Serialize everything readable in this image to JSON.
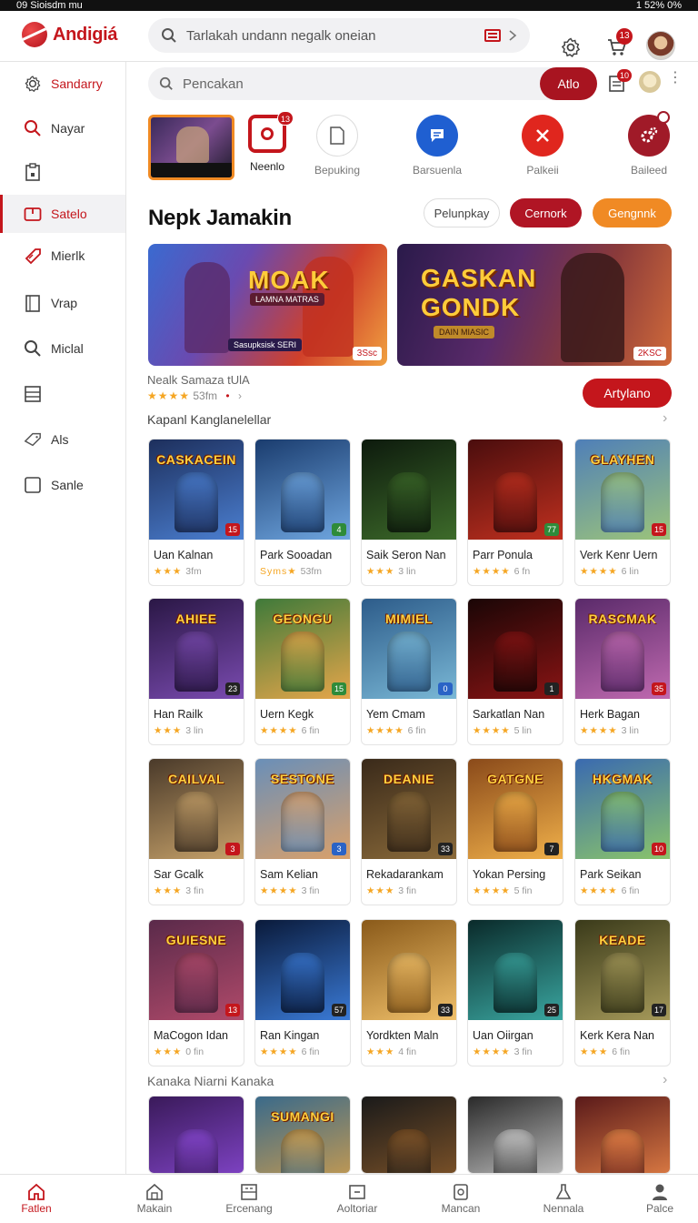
{
  "status_bar": {
    "left": "09 Sioisdm mu",
    "right": "1 52% 0%"
  },
  "app": {
    "name": "Andigiá",
    "brand_color": "#c4161c"
  },
  "top_search": {
    "placeholder": "Tarlakah undann negalk oneian"
  },
  "top_icons": {
    "cart_badge": "13"
  },
  "sidebar": {
    "items": [
      {
        "label": "Sandarry",
        "icon": "gear-icon"
      },
      {
        "label": "Nayar",
        "icon": "search-icon"
      },
      {
        "label": "",
        "icon": "clipboard-icon"
      },
      {
        "label": "Satelo",
        "icon": "folder-icon",
        "active": true
      },
      {
        "label": "Mierlk",
        "icon": "tag-icon"
      },
      {
        "label": "Vrap",
        "icon": "document-icon"
      },
      {
        "label": "Miclal",
        "icon": "search-icon"
      },
      {
        "label": "",
        "icon": "list-icon"
      },
      {
        "label": "Als",
        "icon": "ticket-icon"
      },
      {
        "label": "Sanle",
        "icon": "square-icon"
      }
    ]
  },
  "sub_search": {
    "placeholder": "Pencakan",
    "button": "Atlo",
    "inbox_badge": "10"
  },
  "quick_actions": [
    {
      "label": "Neenlo",
      "badge": "13"
    },
    {
      "label": "Bepuking"
    },
    {
      "label": "Barsuenla"
    },
    {
      "label": "Palkeii"
    },
    {
      "label": "Baileed"
    }
  ],
  "section": {
    "title": "Nepk Jamakin",
    "pills": [
      "Pelunpkay",
      "Cernork",
      "Gengnnk"
    ]
  },
  "banners": [
    {
      "title": "MOAK",
      "subtitle": "LAMNA MATRAS",
      "caption": "Sasupksisk SERI",
      "tag": "3Ssc"
    },
    {
      "title": "GASKAN GONDK",
      "subtitle": "DAIN MIASIC",
      "tag": "2KSC"
    }
  ],
  "featured": {
    "name": "Nealk Samaza tUlA",
    "stars": "★★★★",
    "rating_text": "53fm",
    "action": "Artylano"
  },
  "row_headers": [
    "Kapanl Kanglanelellar",
    "Kanaka Niarni Kanaka"
  ],
  "grid": [
    {
      "name": "Uan Kalnan",
      "stars": "★★★",
      "meta": "3fm",
      "art": "CASKACEIN",
      "num": "15",
      "num_style": "red",
      "c1": "#1d2f5c",
      "c2": "#4b7fd1"
    },
    {
      "name": "Park Sooadan",
      "stars": "Syms★",
      "meta": "53fm",
      "art": "",
      "num": "4",
      "num_style": "green",
      "c1": "#1a3c6e",
      "c2": "#6fa6e0"
    },
    {
      "name": "Saik Seron Nan",
      "stars": "★★★",
      "meta": "3 lin",
      "art": "",
      "num": "",
      "num_style": "dark",
      "c1": "#0d1a0d",
      "c2": "#3d6b2a"
    },
    {
      "name": "Parr Ponula",
      "stars": "★★★★",
      "meta": "6 fn",
      "art": "",
      "num": "77",
      "num_style": "green",
      "c1": "#4a0d0d",
      "c2": "#c0301f"
    },
    {
      "name": "Verk Kenr Uern",
      "stars": "★★★★",
      "meta": "6 lin",
      "art": "GLAYHEN",
      "num": "15",
      "num_style": "red",
      "c1": "#4f7fb8",
      "c2": "#9cc47a"
    },
    {
      "name": "Han Railk",
      "stars": "★★★",
      "meta": "3 lin",
      "art": "AHIEE",
      "num": "23",
      "num_style": "dark",
      "c1": "#2a1745",
      "c2": "#7a4bb0"
    },
    {
      "name": "Uern Kegk",
      "stars": "★★★★",
      "meta": "6 fin",
      "art": "GEONGU",
      "num": "15",
      "num_style": "green",
      "c1": "#3f7a3a",
      "c2": "#e6a64a"
    },
    {
      "name": "Yem Cmam",
      "stars": "★★★★",
      "meta": "6 fin",
      "art": "MIMIEL",
      "num": "0",
      "num_style": "blue",
      "c1": "#2d5c8a",
      "c2": "#7ab8d6"
    },
    {
      "name": "Sarkatlan Nan",
      "stars": "★★★★",
      "meta": "5 lin",
      "art": "",
      "num": "1",
      "num_style": "dark",
      "c1": "#1a0606",
      "c2": "#8a1414"
    },
    {
      "name": "Herk Bagan",
      "stars": "★★★★",
      "meta": "3 lin",
      "art": "RASCMAK",
      "num": "35",
      "num_style": "red",
      "c1": "#5a2a6a",
      "c2": "#c06ab0"
    },
    {
      "name": "Sar Gcalk",
      "stars": "★★★",
      "meta": "3 fin",
      "art": "CAILVAL",
      "num": "3",
      "num_style": "red",
      "c1": "#4a3a2a",
      "c2": "#c7a26a"
    },
    {
      "name": "Sam Kelian",
      "stars": "★★★★",
      "meta": "3 fin",
      "art": "SESTONE",
      "num": "3",
      "num_style": "blue",
      "c1": "#6a8fb8",
      "c2": "#d9a06a"
    },
    {
      "name": "Rekadarankam",
      "stars": "★★★",
      "meta": "3 fin",
      "art": "DEANIE",
      "num": "33",
      "num_style": "dark",
      "c1": "#3a2a1a",
      "c2": "#8a6a3a"
    },
    {
      "name": "Yokan Persing",
      "stars": "★★★★",
      "meta": "5 fin",
      "art": "GATGNE",
      "num": "7",
      "num_style": "dark",
      "c1": "#8a4a1a",
      "c2": "#f0b04a"
    },
    {
      "name": "Park Seikan",
      "stars": "★★★★",
      "meta": "6 fin",
      "art": "HKGMAK",
      "num": "10",
      "num_style": "red",
      "c1": "#3a6ab0",
      "c2": "#8ac46a"
    },
    {
      "name": "MaCogon Idan",
      "stars": "★★★",
      "meta": "0 fin",
      "art": "GUIESNE",
      "num": "13",
      "num_style": "red",
      "c1": "#5a2a4a",
      "c2": "#b04a6a"
    },
    {
      "name": "Ran Kingan",
      "stars": "★★★★",
      "meta": "6 fin",
      "art": "",
      "num": "57",
      "num_style": "dark",
      "c1": "#0a1a3a",
      "c2": "#3a7ad6"
    },
    {
      "name": "Yordkten Maln",
      "stars": "★★★",
      "meta": "4 fin",
      "art": "",
      "num": "33",
      "num_style": "dark",
      "c1": "#8a5a1a",
      "c2": "#f0c06a"
    },
    {
      "name": "Uan Oiirgan",
      "stars": "★★★★",
      "meta": "3 fin",
      "art": "",
      "num": "25",
      "num_style": "dark",
      "c1": "#0a2a2a",
      "c2": "#3aa6a0"
    },
    {
      "name": "Kerk Kera Nan",
      "stars": "★★★",
      "meta": "6 fin",
      "art": "KEADE",
      "num": "17",
      "num_style": "dark",
      "c1": "#3a3a1a",
      "c2": "#a69a5a"
    },
    {
      "name": "",
      "stars": "",
      "meta": "",
      "art": "",
      "num": "",
      "num_style": "dark",
      "c1": "#3a1a5a",
      "c2": "#8a4ad6"
    },
    {
      "name": "",
      "stars": "",
      "meta": "",
      "art": "SUMANGI",
      "num": "",
      "num_style": "dark",
      "c1": "#3a6a8a",
      "c2": "#d6a04a"
    },
    {
      "name": "",
      "stars": "",
      "meta": "",
      "art": "",
      "num": "",
      "num_style": "dark",
      "c1": "#1a1a1a",
      "c2": "#8a5a2a"
    },
    {
      "name": "",
      "stars": "",
      "meta": "",
      "art": "",
      "num": "",
      "num_style": "dark",
      "c1": "#2a2a2a",
      "c2": "#d6d6d6"
    },
    {
      "name": "",
      "stars": "",
      "meta": "",
      "art": "",
      "num": "",
      "num_style": "dark",
      "c1": "#5a1a1a",
      "c2": "#f08a4a"
    }
  ],
  "bottom_nav": [
    {
      "label": "Fatlen",
      "icon": "home-icon",
      "active": true
    },
    {
      "label": "Makain",
      "icon": "store-icon"
    },
    {
      "label": "Ercenang",
      "icon": "grid-icon"
    },
    {
      "label": "Aoltoriar",
      "icon": "window-icon"
    },
    {
      "label": "Mancan",
      "icon": "clock-icon"
    },
    {
      "label": "Nennala",
      "icon": "flask-icon"
    },
    {
      "label": "Palce",
      "icon": "person-icon"
    }
  ]
}
